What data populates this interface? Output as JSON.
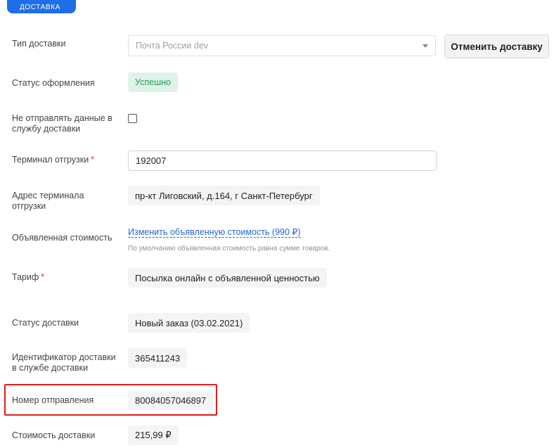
{
  "section": {
    "tab_label": "ДОСТАВКА"
  },
  "fields": {
    "delivery_type": {
      "label": "Тип доставки",
      "value": "Почта России dev"
    },
    "cancel_button": {
      "label": "Отменить доставку"
    },
    "registration_status": {
      "label": "Статус оформления",
      "value": "Успешно"
    },
    "dont_send": {
      "label_line1": "Не отправлять данные в",
      "label_line2": "службу доставки",
      "checked": false
    },
    "terminal": {
      "label": "Терминал отгрузки",
      "required_mark": "*",
      "value": "192007"
    },
    "terminal_address": {
      "label_line1": "Адрес терминала",
      "label_line2": "отгрузки",
      "value": "пр-кт Лиговский, д.164, г Санкт-Петербург"
    },
    "declared_value": {
      "label": "Объявленная стоимость",
      "link_text": "Изменить объявленную стоимость (990 ₽)",
      "hint": "По умолчанию объявленная стоимость равна сумме товаров."
    },
    "tariff": {
      "label": "Тариф",
      "required_mark": "*",
      "value": "Посылка онлайн с объявленной ценностью"
    },
    "delivery_status": {
      "label": "Статус доставки",
      "value": "Новый заказ (03.02.2021)"
    },
    "delivery_id": {
      "label_line1": "Идентификатор доставки",
      "label_line2": "в службе доставки",
      "value": "365411243"
    },
    "shipment_number": {
      "label": "Номер отправления",
      "value": "80084057046897"
    },
    "delivery_cost": {
      "label": "Стоимость доставки",
      "value": "215,99 ₽"
    }
  },
  "colors": {
    "accent": "#1e6ee8",
    "success_bg": "#dff4e8",
    "success_text": "#1e9b56",
    "highlight": "#e01b1b",
    "link": "#2367d6"
  }
}
